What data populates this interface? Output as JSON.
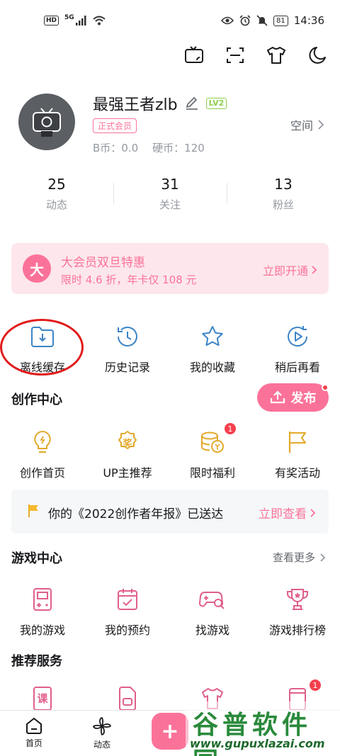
{
  "status_bar": {
    "left_badges": [
      "HD",
      "5G"
    ],
    "battery": "81",
    "time": "14:36"
  },
  "top_icons": [
    "tv-cast-icon",
    "scan-icon",
    "tshirt-icon",
    "moon-icon"
  ],
  "profile": {
    "username": "最强王者zlb",
    "level": "LV2",
    "member_badge": "正式会员",
    "bcoin": "B币：0.0",
    "coin": "硬币：120",
    "space_label": "空间"
  },
  "stats": [
    {
      "num": "25",
      "label": "动态"
    },
    {
      "num": "31",
      "label": "关注"
    },
    {
      "num": "13",
      "label": "粉丝"
    }
  ],
  "vip": {
    "logo": "大",
    "title": "大会员双旦特惠",
    "subtitle": "限时 4.6 折，年卡仅 108 元",
    "cta": "立即开通"
  },
  "quick_actions": [
    {
      "label": "离线缓存",
      "icon": "download-folder-icon"
    },
    {
      "label": "历史记录",
      "icon": "history-clock-icon"
    },
    {
      "label": "我的收藏",
      "icon": "star-icon"
    },
    {
      "label": "稍后再看",
      "icon": "watch-later-icon"
    }
  ],
  "creator": {
    "title": "创作中心",
    "publish_label": "发布",
    "items": [
      {
        "label": "创作首页",
        "icon": "lightbulb-icon"
      },
      {
        "label": "UP主推荐",
        "icon": "award-icon",
        "glyph": "奖"
      },
      {
        "label": "限时福利",
        "icon": "coins-icon",
        "badge": "1"
      },
      {
        "label": "有奖活动",
        "icon": "flag-icon"
      }
    ]
  },
  "notice": {
    "text": "你的《2022创作者年报》已送达",
    "cta": "立即查看"
  },
  "game": {
    "title": "游戏中心",
    "more": "查看更多",
    "items": [
      {
        "label": "我的游戏",
        "icon": "gameboy-icon"
      },
      {
        "label": "我的预约",
        "icon": "calendar-check-icon"
      },
      {
        "label": "找游戏",
        "icon": "gamepad-search-icon"
      },
      {
        "label": "游戏排行榜",
        "icon": "trophy-icon"
      }
    ]
  },
  "recommend": {
    "title": "推荐服务",
    "course_glyph": "课",
    "badge": "1"
  },
  "tabs": [
    {
      "label": "首页",
      "icon": "home-icon"
    },
    {
      "label": "动态",
      "icon": "pinwheel-icon"
    }
  ],
  "fab_label": "+",
  "watermark": {
    "title": "谷普软件园",
    "url": "www.gupuxlazai.com"
  },
  "colors": {
    "accent": "#fb7299",
    "blue_icon": "#3c84c6",
    "yellow_icon": "#e3a92c",
    "pink_icon": "#e0608a",
    "text": "#18191c",
    "muted": "#9499a0"
  }
}
